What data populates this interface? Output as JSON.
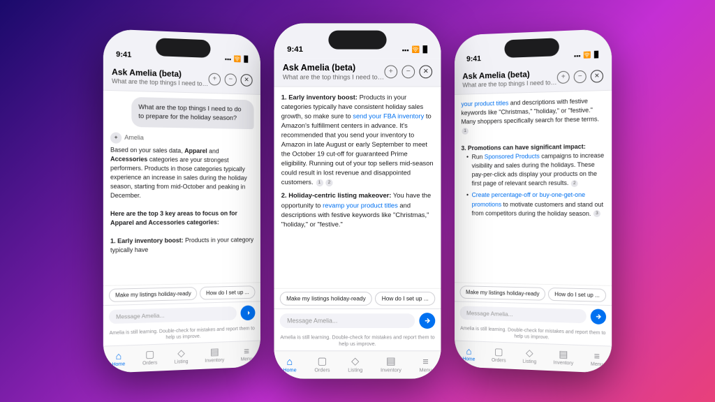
{
  "background": {
    "gradient": "135deg, #1a0a6b 0%, #6b1a9e 30%, #c42fd4 60%, #e8407a 100%"
  },
  "phones": [
    {
      "id": "phone-1",
      "time": "9:41",
      "header": {
        "title": "Ask Amelia (beta)",
        "subtitle": "What are the top things I need to do..."
      },
      "user_message": "What are the top things I need to do to prepare for the holiday season?",
      "amelia_label": "Amelia",
      "response_paragraphs": [
        "Based on your sales data, Apparel and Accessories categories are your strongest performers. Products in those categories typically experience an increase in sales during the holiday season, starting from mid-October and peaking in December.",
        "Here are the top 3 key areas to focus on for Apparel and Accessories categories:",
        "1. Early inventory boost: Products in your category typically have"
      ],
      "chips": [
        "Make my listings holiday-ready",
        "How do I set up ..."
      ],
      "input_placeholder": "Message Amelia...",
      "disclaimer": "Amelia is still learning. Double-check for mistakes and report them to help us improve.",
      "nav": [
        "Home",
        "Orders",
        "Listing",
        "Inventory",
        "Menu"
      ]
    },
    {
      "id": "phone-2",
      "time": "9:41",
      "header": {
        "title": "Ask Amelia (beta)",
        "subtitle": "What are the top things I need to do..."
      },
      "items": [
        {
          "num": "1.",
          "title": "Early inventory boost:",
          "text": "Products in your categories typically have consistent holiday sales growth, so make sure to send your FBA inventory to Amazon's fulfillment centers in advance. It's recommended that you send your inventory to Amazon in late August or early September to meet the October 19 cut-off for guaranteed Prime eligibility. Running out of your top sellers mid-season could result in lost revenue and disappointed customers.",
          "refs": [
            "1",
            "2"
          ],
          "link_text": "send your FBA inventory"
        },
        {
          "num": "2.",
          "title": "Holiday-centric listing makeover:",
          "text": "You have the opportunity to revamp your product titles and descriptions with festive keywords like \"Christmas,\" \"holiday,\" or \"festive.\"",
          "link_text": "revamp your product titles"
        }
      ],
      "chips": [
        "Make my listings holiday-ready",
        "How do I set up ..."
      ],
      "input_placeholder": "Message Amelia...",
      "disclaimer": "Amelia is still learning. Double-check for mistakes and report them to help us improve.",
      "nav": [
        "Home",
        "Orders",
        "Listing",
        "Inventory",
        "Menu"
      ]
    },
    {
      "id": "phone-3",
      "time": "9:41",
      "header": {
        "title": "Ask Amelia (beta)",
        "subtitle": "What are the top things I need to do..."
      },
      "pretext": "your product titles and descriptions with festive keywords like \"Christmas,\" \"holiday,\" or \"festive.\" Many shoppers specifically search for these terms.",
      "link_text": "your product titles",
      "item3": {
        "num": "3.",
        "title": "Promotions can have significant impact:",
        "bullets": [
          {
            "text": "Run Sponsored Products campaigns to increase visibility and sales during the holidays. These pay-per-click ads display your products on the first page of relevant search results.",
            "link": "Sponsored Products",
            "ref": "2"
          },
          {
            "text": "Create percentage-off or buy-one-get-one promotions to motivate customers and stand out from competitors during the holiday season.",
            "link": "Create percentage-off or buy-one-get-one promotions",
            "ref": "3"
          }
        ]
      },
      "chips": [
        "Make my listings holiday-ready",
        "How do I set up ..."
      ],
      "input_placeholder": "Message Amelia...",
      "disclaimer": "Amelia is still learning. Double-check for mistakes and report them to help us improve.",
      "nav": [
        "Home",
        "Orders",
        "Listing",
        "Inventory",
        "Menu"
      ]
    }
  ],
  "nav_items": [
    {
      "label": "Home",
      "icon": "⌂",
      "active": true
    },
    {
      "label": "Orders",
      "icon": "□",
      "active": false
    },
    {
      "label": "Listing",
      "icon": "◇",
      "active": false
    },
    {
      "label": "Inventory",
      "icon": "▦",
      "active": false
    },
    {
      "label": "Menu",
      "icon": "≡",
      "active": false
    }
  ]
}
